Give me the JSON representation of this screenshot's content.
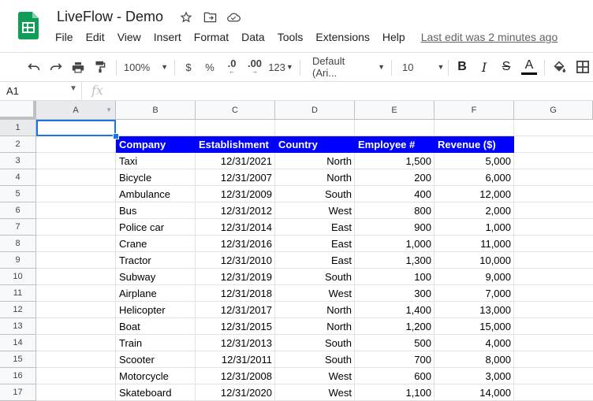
{
  "doc": {
    "title": "LiveFlow - Demo",
    "menu": [
      "File",
      "Edit",
      "View",
      "Insert",
      "Format",
      "Data",
      "Tools",
      "Extensions",
      "Help"
    ],
    "last_edit": "Last edit was 2 minutes ago"
  },
  "toolbar": {
    "zoom": "100%",
    "currency": "$",
    "percent": "%",
    "dec_decrease": ".0",
    "dec_increase": ".00",
    "more_formats": "123",
    "font": "Default (Ari...",
    "font_size": "10",
    "bold": "B",
    "italic": "I",
    "strike": "S",
    "text_color": "A"
  },
  "formula_bar": {
    "name_box": "A1",
    "fx": "fx"
  },
  "columns": [
    "A",
    "B",
    "C",
    "D",
    "E",
    "F",
    "G"
  ],
  "rows": [
    "1",
    "2",
    "3",
    "4",
    "5",
    "6",
    "7",
    "8",
    "9",
    "10",
    "11",
    "12",
    "13",
    "14",
    "15",
    "16",
    "17"
  ],
  "table": {
    "headers": [
      "Company",
      "Establishment",
      "Country",
      "Employee #",
      "Revenue ($)"
    ],
    "rows": [
      [
        "Taxi",
        "12/31/2021",
        "North",
        "1,500",
        "5,000"
      ],
      [
        "Bicycle",
        "12/31/2007",
        "North",
        "200",
        "6,000"
      ],
      [
        "Ambulance",
        "12/31/2009",
        "South",
        "400",
        "12,000"
      ],
      [
        "Bus",
        "12/31/2012",
        "West",
        "800",
        "2,000"
      ],
      [
        "Police car",
        "12/31/2014",
        "East",
        "900",
        "1,000"
      ],
      [
        "Crane",
        "12/31/2016",
        "East",
        "1,000",
        "11,000"
      ],
      [
        "Tractor",
        "12/31/2010",
        "East",
        "1,300",
        "10,000"
      ],
      [
        "Subway",
        "12/31/2019",
        "South",
        "100",
        "9,000"
      ],
      [
        "Airplane",
        "12/31/2018",
        "West",
        "300",
        "7,000"
      ],
      [
        "Helicopter",
        "12/31/2017",
        "North",
        "1,400",
        "13,000"
      ],
      [
        "Boat",
        "12/31/2015",
        "North",
        "1,200",
        "15,000"
      ],
      [
        "Train",
        "12/31/2013",
        "South",
        "500",
        "4,000"
      ],
      [
        "Scooter",
        "12/31/2011",
        "South",
        "700",
        "8,000"
      ],
      [
        "Motorcycle",
        "12/31/2008",
        "West",
        "600",
        "3,000"
      ],
      [
        "Skateboard",
        "12/31/2020",
        "West",
        "1,100",
        "14,000"
      ]
    ]
  },
  "colors": {
    "header_fill": "#0000ff",
    "selection": "#1a73e8",
    "sheets_green": "#0f9d58"
  }
}
